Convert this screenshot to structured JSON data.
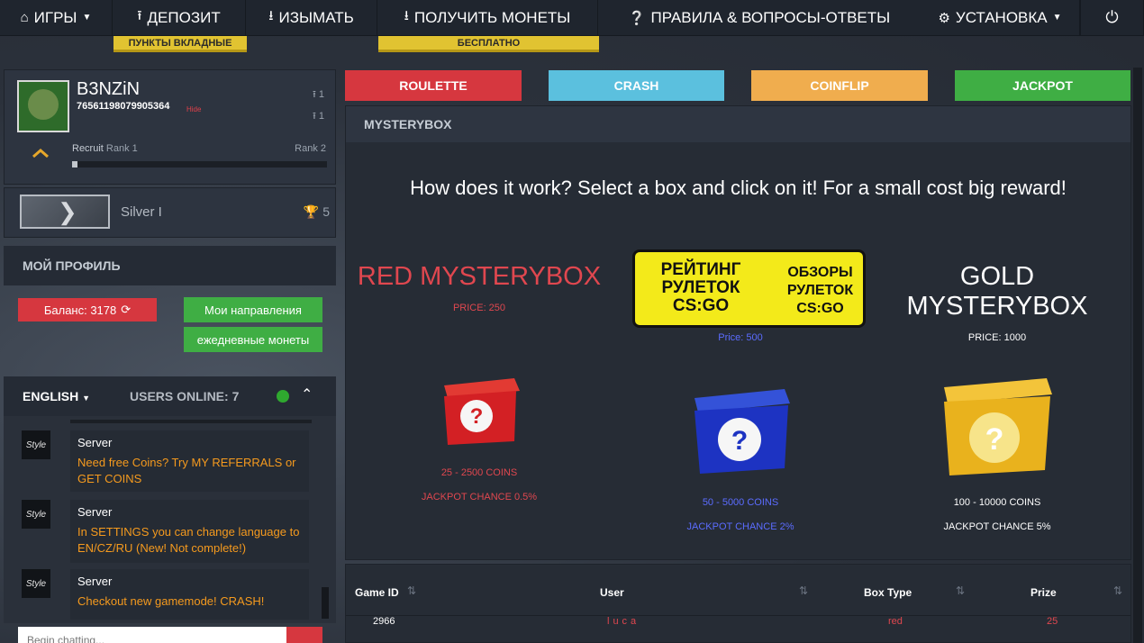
{
  "nav": {
    "games": "ИГРЫ",
    "deposit": "ДЕПОЗИТ",
    "deposit_tag": "ПУНКТЫ ВКЛАДНЫЕ",
    "withdraw": "ИЗЫМАТЬ",
    "get_coins": "ПОЛУЧИТЬ МОНЕТЫ",
    "get_coins_tag": "БЕСПЛАТНО",
    "rules": "ПРАВИЛА & ВОПРОСЫ-ОТВЕТЫ",
    "settings": "УСТАНОВКА"
  },
  "profile": {
    "username": "B3NZiN",
    "steam_id": "76561198079905364",
    "hide": "Hide",
    "up_count_1": "1",
    "up_count_2": "1",
    "rank_from_name": "Recruit",
    "rank_from": "Rank 1",
    "rank_to": "Rank 2",
    "rank_progress_percent": 2,
    "skill_rank": "Silver I",
    "trophies": "5"
  },
  "my_profile": {
    "title": "МОЙ ПРОФИЛЬ",
    "balance": "Баланс: 3178",
    "directions": "Мои направления",
    "daily_coins": "ежедневные монеты"
  },
  "chat": {
    "language": "ENGLISH",
    "users_online": "USERS ONLINE: 7",
    "messages": [
      {
        "avatar": "Style",
        "user": "Server",
        "text": "Need free Coins? Try MY REFERRALS or GET COINS"
      },
      {
        "avatar": "Style",
        "user": "Server",
        "text": "In SETTINGS you can change language to EN/CZ/RU (New! Not complete!)"
      },
      {
        "avatar": "Style",
        "user": "Server",
        "text": "Checkout new gamemode! CRASH!"
      }
    ],
    "input_placeholder": "Begin chatting..."
  },
  "modes": [
    "ROULETTE",
    "CRASH",
    "COINFLIP",
    "JACKPOT"
  ],
  "mysterybox": {
    "title": "MYSTERYBOX",
    "headline": "How does it work? Select a box and click on it! For a small cost big reward!",
    "boxes": [
      {
        "title": "RED MYSTERYBOX",
        "price": "PRICE: 250",
        "coins": "25 - 2500 COINS",
        "chance": "JACKPOT CHANCE 0.5%",
        "color": "#e0474f"
      },
      {
        "title": "",
        "price": "Price: 500",
        "coins": "50 - 5000 COINS",
        "chance": "JACKPOT CHANCE 2%",
        "color": "#5b6cff"
      },
      {
        "title": "GOLD MYSTERYBOX",
        "price": "PRICE: 1000",
        "coins": "100 - 10000 COINS",
        "chance": "JACKPOT CHANCE 5%",
        "color": "#ffffff"
      }
    ],
    "ad": {
      "left": "РЕЙТИНГ РУЛЕТОК CS:GO",
      "right": "ОБЗОРЫ РУЛЕТОК CS:GO"
    }
  },
  "history": {
    "columns": [
      "Game ID",
      "User",
      "Box Type",
      "Prize"
    ],
    "rows": [
      {
        "game_id": "2966",
        "user": "luca",
        "box_type": "red",
        "prize": "25"
      }
    ]
  },
  "colors": {
    "red": "#d6373f",
    "blue": "#5bc0de",
    "orange": "#f0ad4e",
    "green": "#3fae44",
    "tag_yellow": "#e1c331"
  }
}
